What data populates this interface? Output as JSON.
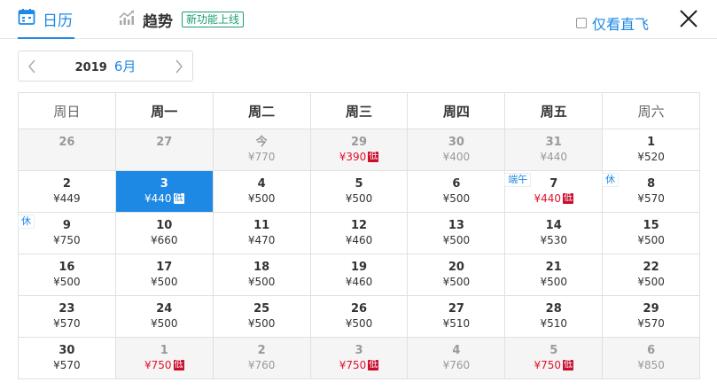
{
  "tabs": {
    "calendar_label": "日历",
    "trend_label": "趋势",
    "new_badge": "新功能上线",
    "direct_only_label": "仅看直飞"
  },
  "month_nav": {
    "year": "2019",
    "month": "6月"
  },
  "colors": {
    "accent": "#1e88e5",
    "low_price": "#e0142d",
    "badge_green": "#1a9e6e"
  },
  "weekdays": [
    "周日",
    "周一",
    "周二",
    "周三",
    "周四",
    "周五",
    "周六"
  ],
  "low_tag": "低",
  "weeks": [
    [
      {
        "d": "26",
        "p": "",
        "state": "past"
      },
      {
        "d": "27",
        "p": "",
        "state": "past"
      },
      {
        "d": "今",
        "p": "¥770",
        "state": "today"
      },
      {
        "d": "29",
        "p": "¥390",
        "state": "past",
        "low": true
      },
      {
        "d": "30",
        "p": "¥400",
        "state": "past"
      },
      {
        "d": "31",
        "p": "¥440",
        "state": "past"
      },
      {
        "d": "1",
        "p": "¥520",
        "state": "normal"
      }
    ],
    [
      {
        "d": "2",
        "p": "¥449",
        "state": "normal"
      },
      {
        "d": "3",
        "p": "¥440",
        "state": "selected",
        "low": true
      },
      {
        "d": "4",
        "p": "¥500",
        "state": "normal"
      },
      {
        "d": "5",
        "p": "¥500",
        "state": "normal"
      },
      {
        "d": "6",
        "p": "¥500",
        "state": "normal"
      },
      {
        "d": "7",
        "p": "¥440",
        "state": "normal",
        "low": true,
        "tag": "端午"
      },
      {
        "d": "8",
        "p": "¥570",
        "state": "normal",
        "tag": "休"
      }
    ],
    [
      {
        "d": "9",
        "p": "¥750",
        "state": "normal",
        "tag": "休"
      },
      {
        "d": "10",
        "p": "¥660",
        "state": "normal"
      },
      {
        "d": "11",
        "p": "¥470",
        "state": "normal"
      },
      {
        "d": "12",
        "p": "¥460",
        "state": "normal"
      },
      {
        "d": "13",
        "p": "¥500",
        "state": "normal"
      },
      {
        "d": "14",
        "p": "¥530",
        "state": "normal"
      },
      {
        "d": "15",
        "p": "¥500",
        "state": "normal"
      }
    ],
    [
      {
        "d": "16",
        "p": "¥500",
        "state": "normal"
      },
      {
        "d": "17",
        "p": "¥500",
        "state": "normal"
      },
      {
        "d": "18",
        "p": "¥500",
        "state": "normal"
      },
      {
        "d": "19",
        "p": "¥460",
        "state": "normal"
      },
      {
        "d": "20",
        "p": "¥500",
        "state": "normal"
      },
      {
        "d": "21",
        "p": "¥500",
        "state": "normal"
      },
      {
        "d": "22",
        "p": "¥500",
        "state": "normal"
      }
    ],
    [
      {
        "d": "23",
        "p": "¥570",
        "state": "normal"
      },
      {
        "d": "24",
        "p": "¥500",
        "state": "normal"
      },
      {
        "d": "25",
        "p": "¥500",
        "state": "normal"
      },
      {
        "d": "26",
        "p": "¥500",
        "state": "normal"
      },
      {
        "d": "27",
        "p": "¥510",
        "state": "normal"
      },
      {
        "d": "28",
        "p": "¥510",
        "state": "normal"
      },
      {
        "d": "29",
        "p": "¥570",
        "state": "normal"
      }
    ],
    [
      {
        "d": "30",
        "p": "¥570",
        "state": "normal"
      },
      {
        "d": "1",
        "p": "¥750",
        "state": "out",
        "low": true
      },
      {
        "d": "2",
        "p": "¥760",
        "state": "out"
      },
      {
        "d": "3",
        "p": "¥750",
        "state": "out",
        "low": true
      },
      {
        "d": "4",
        "p": "¥760",
        "state": "out"
      },
      {
        "d": "5",
        "p": "¥750",
        "state": "out",
        "low": true
      },
      {
        "d": "6",
        "p": "¥850",
        "state": "out"
      }
    ]
  ]
}
